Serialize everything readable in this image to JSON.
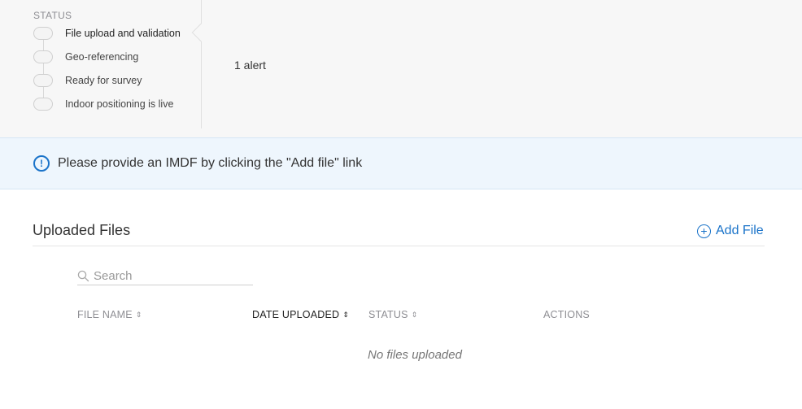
{
  "status_panel": {
    "heading": "STATUS",
    "steps": [
      {
        "label": "File upload and validation",
        "active": true
      },
      {
        "label": "Geo-referencing",
        "active": false
      },
      {
        "label": "Ready for survey",
        "active": false
      },
      {
        "label": "Indoor positioning is live",
        "active": false
      }
    ],
    "alert_count": "1 alert"
  },
  "info_banner": {
    "icon": "info-circle-icon",
    "message": "Please provide an IMDF by clicking the \"Add file\" link"
  },
  "files": {
    "title": "Uploaded Files",
    "add_label": "Add File",
    "search": {
      "placeholder": "Search",
      "value": ""
    },
    "columns": [
      {
        "label": "FILE NAME",
        "sortable": true,
        "sorted": false
      },
      {
        "label": "DATE UPLOADED",
        "sortable": true,
        "sorted": true
      },
      {
        "label": "STATUS",
        "sortable": true,
        "sorted": false
      },
      {
        "label": "ACTIONS",
        "sortable": false,
        "sorted": false
      }
    ],
    "empty_message": "No files uploaded"
  },
  "colors": {
    "accent": "#1a73c9",
    "banner_bg": "#eef6fd",
    "panel_bg": "#f7f7f7"
  }
}
